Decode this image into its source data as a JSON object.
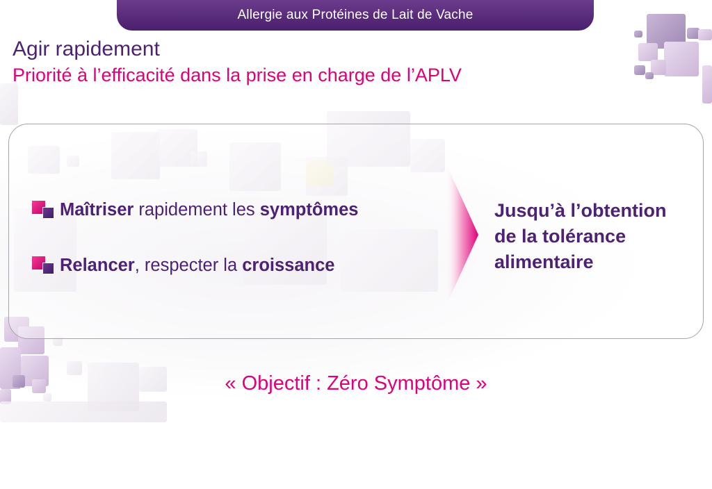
{
  "banner": {
    "text": "Allergie aux Protéines de Lait de Vache"
  },
  "heading": {
    "title": "Agir rapidement",
    "subtitle": "Priorité à l’efficacité dans la prise en charge de l’APLV"
  },
  "bullets": [
    {
      "parts": [
        {
          "text": "Maîtriser",
          "bold": true
        },
        {
          "text": " rapidement les ",
          "bold": false
        },
        {
          "text": "symptômes",
          "bold": true
        }
      ]
    },
    {
      "parts": [
        {
          "text": "Relancer",
          "bold": true
        },
        {
          "text": ", respecter la ",
          "bold": false
        },
        {
          "text": "croissance",
          "bold": true
        }
      ]
    }
  ],
  "result": {
    "lines": [
      "Jusqu’à l’obtention",
      "de la tolérance",
      "alimentaire"
    ]
  },
  "objective": {
    "text": "« Objectif : Zéro Symptôme »"
  },
  "icons": {
    "bullet": "pink-purple-squares-bullet-icon",
    "arrow": "pink-chevron-arrow-icon"
  },
  "colors": {
    "banner": "#4a1f6c",
    "title": "#4d2274",
    "accent": "#e0007a",
    "frame_border": "#a7a3a9"
  }
}
